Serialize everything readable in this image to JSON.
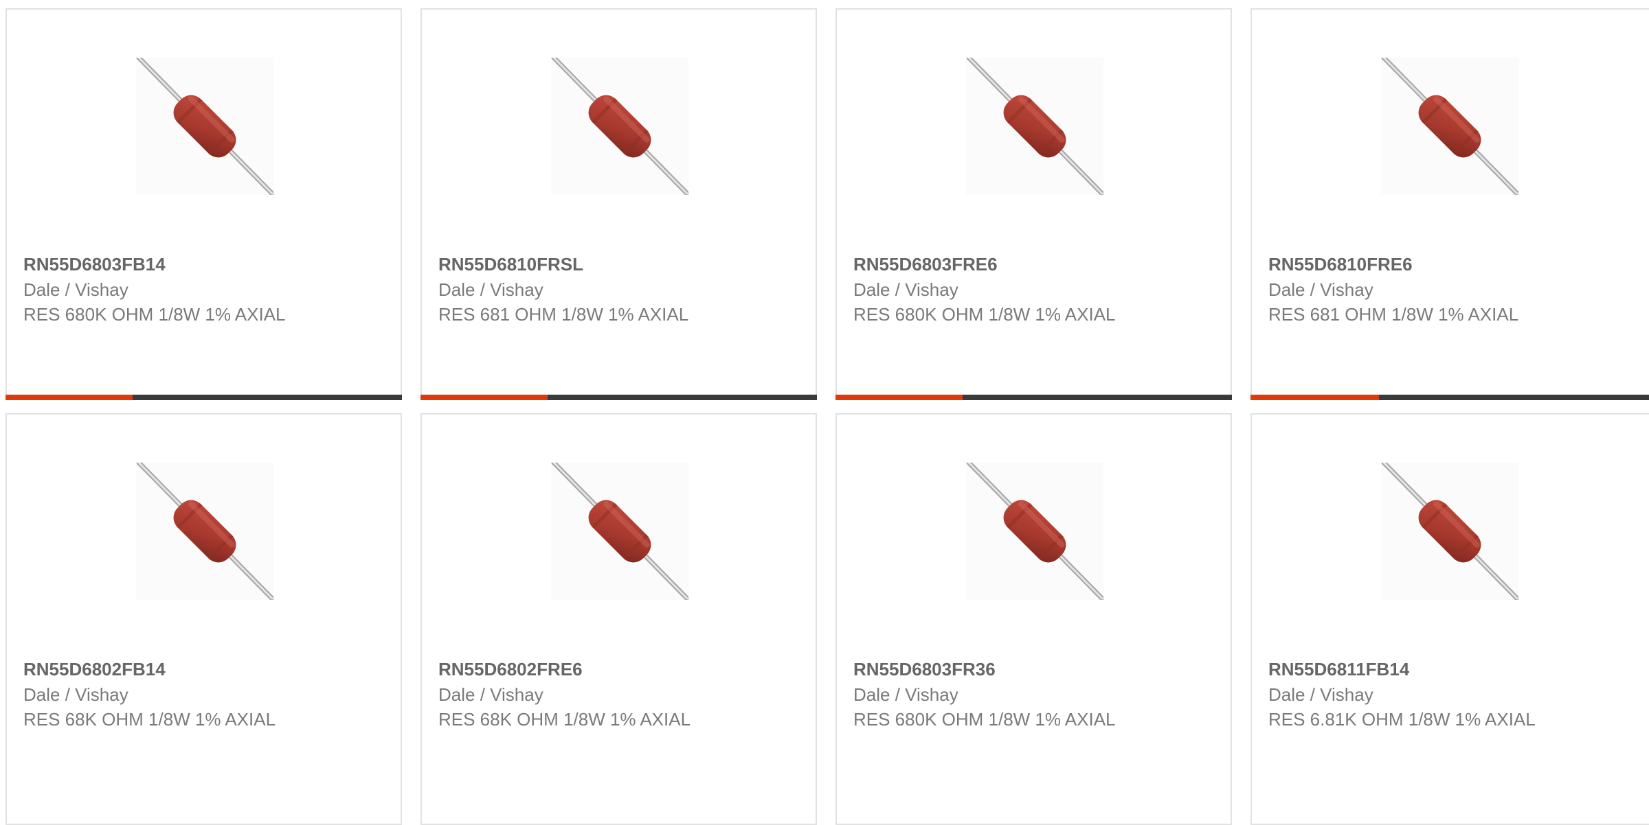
{
  "colors": {
    "accent": "#e2380b",
    "track": "#3a3a3a",
    "card_border": "#e2e2e2",
    "text_primary": "#666666",
    "text_secondary": "#7a7a7a",
    "resistor_body": "#a7392e",
    "lead": "#c8c8c8"
  },
  "products": [
    {
      "part_number": "RN55D6803FB14",
      "manufacturer": "Dale / Vishay",
      "description": "RES 680K OHM 1/8W 1% AXIAL",
      "image_icon": "axial-resistor-icon",
      "progress": 0.32
    },
    {
      "part_number": "RN55D6810FRSL",
      "manufacturer": "Dale / Vishay",
      "description": "RES 681 OHM 1/8W 1% AXIAL",
      "image_icon": "axial-resistor-icon",
      "progress": 0.32
    },
    {
      "part_number": "RN55D6803FRE6",
      "manufacturer": "Dale / Vishay",
      "description": "RES 680K OHM 1/8W 1% AXIAL",
      "image_icon": "axial-resistor-icon",
      "progress": 0.32
    },
    {
      "part_number": "RN55D6810FRE6",
      "manufacturer": "Dale / Vishay",
      "description": "RES 681 OHM 1/8W 1% AXIAL",
      "image_icon": "axial-resistor-icon",
      "progress": 0.32
    },
    {
      "part_number": "RN55D6802FB14",
      "manufacturer": "Dale / Vishay",
      "description": "RES 68K OHM 1/8W 1% AXIAL",
      "image_icon": "axial-resistor-icon"
    },
    {
      "part_number": "RN55D6802FRE6",
      "manufacturer": "Dale / Vishay",
      "description": "RES 68K OHM 1/8W 1% AXIAL",
      "image_icon": "axial-resistor-icon"
    },
    {
      "part_number": "RN55D6803FR36",
      "manufacturer": "Dale / Vishay",
      "description": "RES 680K OHM 1/8W 1% AXIAL",
      "image_icon": "axial-resistor-icon"
    },
    {
      "part_number": "RN55D6811FB14",
      "manufacturer": "Dale / Vishay",
      "description": "RES 6.81K OHM 1/8W 1% AXIAL",
      "image_icon": "axial-resistor-icon"
    }
  ]
}
